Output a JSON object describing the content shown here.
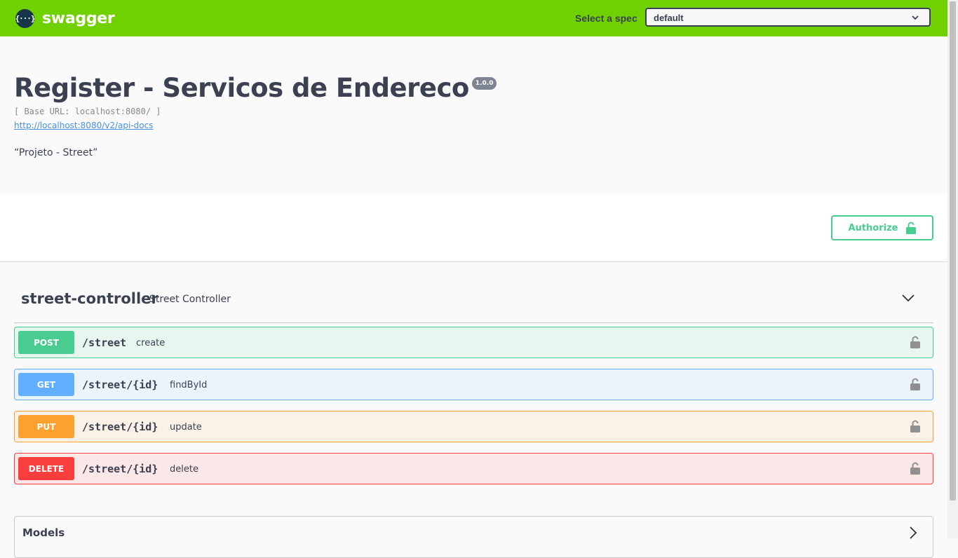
{
  "topbar": {
    "logo_glyph": "{···}",
    "logo_text": "swagger",
    "spec_label": "Select a spec",
    "spec_selected": "default",
    "bg_color": "#6fd100"
  },
  "info": {
    "title": "Register - Servicos de Endereco",
    "version": "1.0.0",
    "base_url": "[ Base URL: localhost:8080/ ]",
    "api_docs_link": "http://localhost:8080/v2/api-docs",
    "description": "“Projeto - Street”"
  },
  "auth": {
    "authorize_label": "Authorize",
    "icon": "unlock-icon"
  },
  "controller": {
    "name": "street-controller",
    "description": "Street Controller",
    "expanded": true,
    "operations": [
      {
        "method": "POST",
        "path": "/street",
        "summary": "create",
        "color": "#49cc90"
      },
      {
        "method": "GET",
        "path": "/street/{id}",
        "summary": "findById",
        "color": "#61affe"
      },
      {
        "method": "PUT",
        "path": "/street/{id}",
        "summary": "update",
        "color": "#fca130"
      },
      {
        "method": "DELETE",
        "path": "/street/{id}",
        "summary": "delete",
        "color": "#f93e3e"
      }
    ]
  },
  "models": {
    "title": "Models"
  }
}
